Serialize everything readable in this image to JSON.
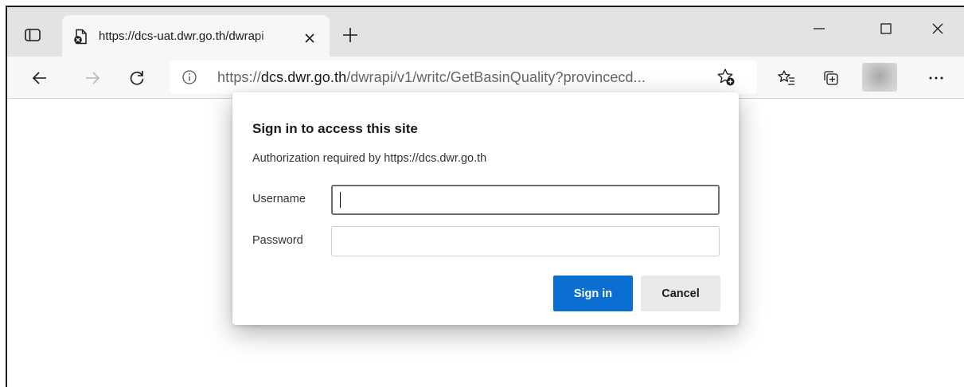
{
  "tab": {
    "title": "https://dcs-uat.dwr.go.th/dwrapi",
    "favicon_icon": "page-blocked-icon"
  },
  "address_bar": {
    "url_scheme": "https://",
    "url_host": "dcs.dwr.go.th",
    "url_path": "/dwrapi/v1/writc/GetBasinQuality?provincecd..."
  },
  "dialog": {
    "title": "Sign in to access this site",
    "subtitle": "Authorization required by https://dcs.dwr.go.th",
    "username_label": "Username",
    "username_value": "",
    "password_label": "Password",
    "password_value": "",
    "signin_label": "Sign in",
    "cancel_label": "Cancel"
  },
  "colors": {
    "titlebar": "#e3e3e3",
    "toolbar": "#f7f7f7",
    "primary_button": "#0a6fd0",
    "secondary_button": "#e9e9e9"
  },
  "icons": {
    "window": [
      "tab-actions-icon",
      "minimize-icon",
      "maximize-icon",
      "close-window-icon"
    ],
    "toolbar": [
      "back-arrow-icon",
      "forward-arrow-icon",
      "refresh-icon",
      "info-icon",
      "add-favorite-icon",
      "favorites-icon",
      "collections-icon",
      "more-icon"
    ]
  }
}
